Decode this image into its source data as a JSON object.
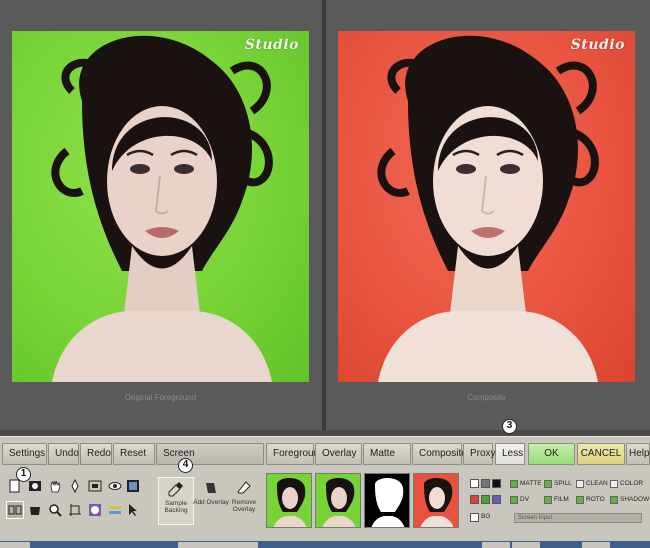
{
  "viewer_left": {
    "caption": "Original Foreground",
    "watermark": "Studio"
  },
  "viewer_right": {
    "caption": "Composite",
    "watermark": "Studio"
  },
  "toolbar": {
    "buttons": {
      "settings": "Settings",
      "undo": "Undo",
      "redo": "Redo",
      "reset": "Reset",
      "screen": "Screen",
      "foreground": "Foreground",
      "overlay": "Overlay",
      "matte": "Matte",
      "composite": "Composite",
      "proxy": "Proxy",
      "less": "Less",
      "ok": "OK",
      "cancel": "CANCEL",
      "help": "Help"
    },
    "callouts": [
      "1",
      "3",
      "4"
    ],
    "big_buttons": {
      "sample_backing": "Sample Backing",
      "add_overlay": "Add Overlay",
      "remove_overlay": "Remove Overlay"
    },
    "thumbnails": [
      "Foreground",
      "Overlay",
      "Matte",
      "Composite"
    ],
    "swatch_label": "BG",
    "options": {
      "matte": "MATTE",
      "spill": "SPILL",
      "clean": "CLEAN",
      "color": "COLOR",
      "dv": "DV",
      "film": "FILM",
      "roto": "ROTO",
      "shadow": "SHADOW"
    },
    "status_field": "Screen Input"
  },
  "colors": {
    "green_screen": "#77d437",
    "red_background": "#e8533f",
    "ok_button": "#a9e488",
    "cancel_button": "#e4d98c",
    "toolbar_bg": "#c9c6bd"
  }
}
